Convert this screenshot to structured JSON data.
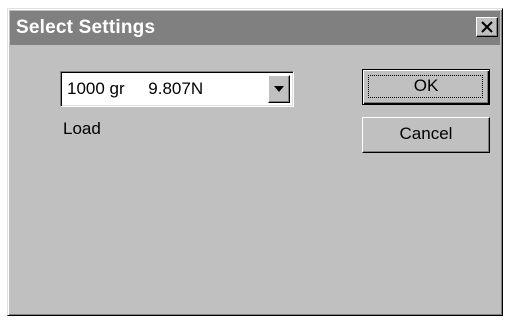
{
  "dialog": {
    "title": "Select Settings",
    "close_icon": "close-x-icon"
  },
  "load": {
    "selected_value": "1000 gr     9.807N",
    "label": "Load",
    "dropdown_icon": "chevron-down-icon"
  },
  "buttons": {
    "ok_label": "OK",
    "cancel_label": "Cancel"
  },
  "colors": {
    "titlebar": "#808080",
    "dialog_face": "#c0c0c0",
    "field_bg": "#ffffff"
  }
}
